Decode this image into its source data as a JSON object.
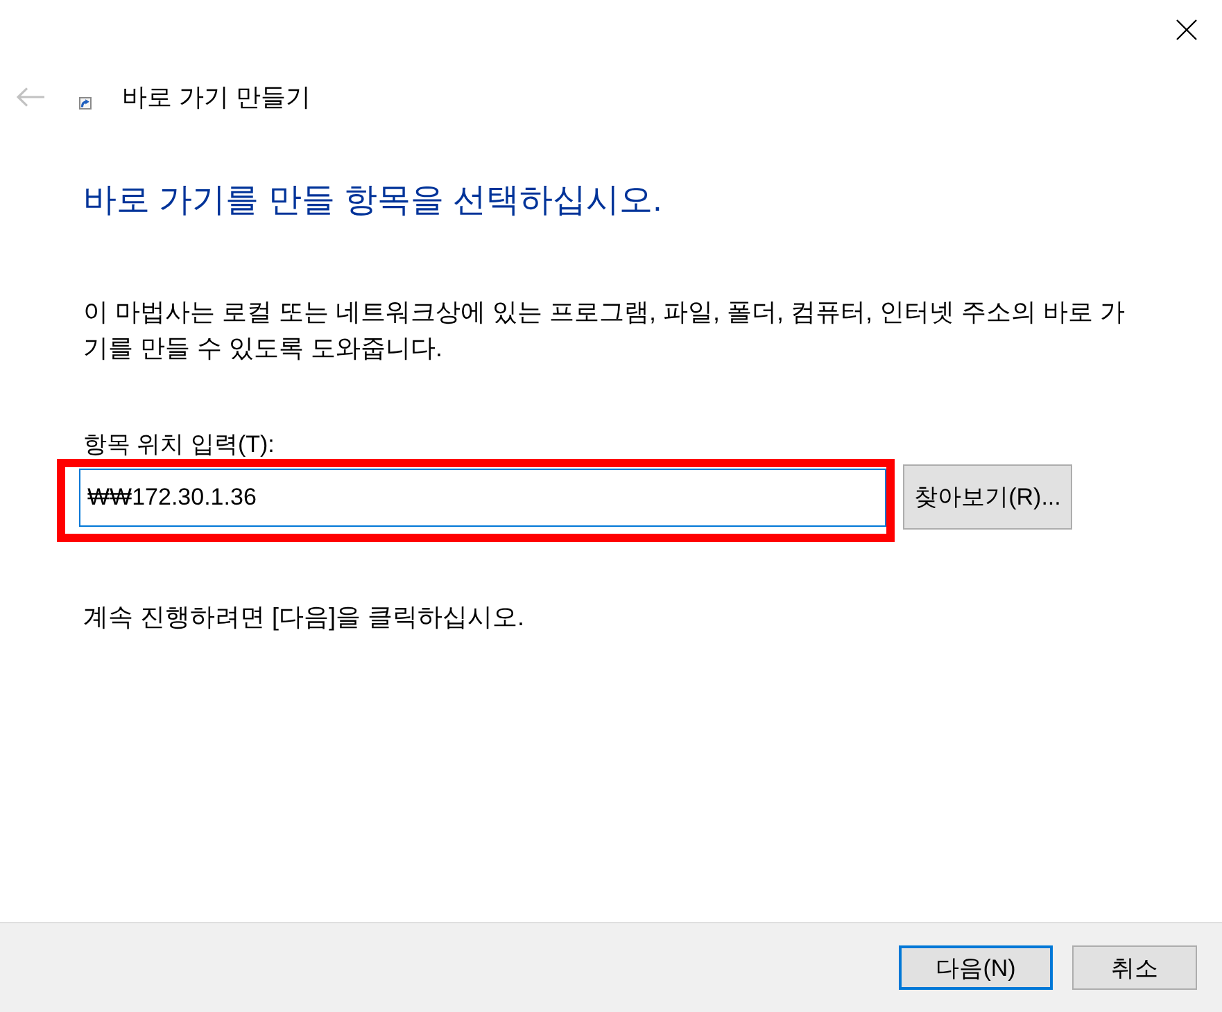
{
  "header": {
    "back_button": {
      "disabled": true
    },
    "title": "바로 가기 만들기"
  },
  "heading": "바로 가기를 만들 항목을 선택하십시오.",
  "description": "이 마법사는 로컬 또는 네트워크상에 있는 프로그램, 파일, 폴더, 컴퓨터, 인터넷 주소의 바로 가기를 만들 수 있도록 도와줍니다.",
  "location": {
    "label": "항목 위치 입력(T):",
    "value": "₩₩172.30.1.36",
    "focused": true,
    "highlighted": true,
    "browse_button": "찾아보기(R)..."
  },
  "hint": "계속 진행하려면 [다음]을 클릭하십시오.",
  "buttons": [
    {
      "label": "다음(N)",
      "default": true
    },
    {
      "label": "취소",
      "default": false
    }
  ]
}
